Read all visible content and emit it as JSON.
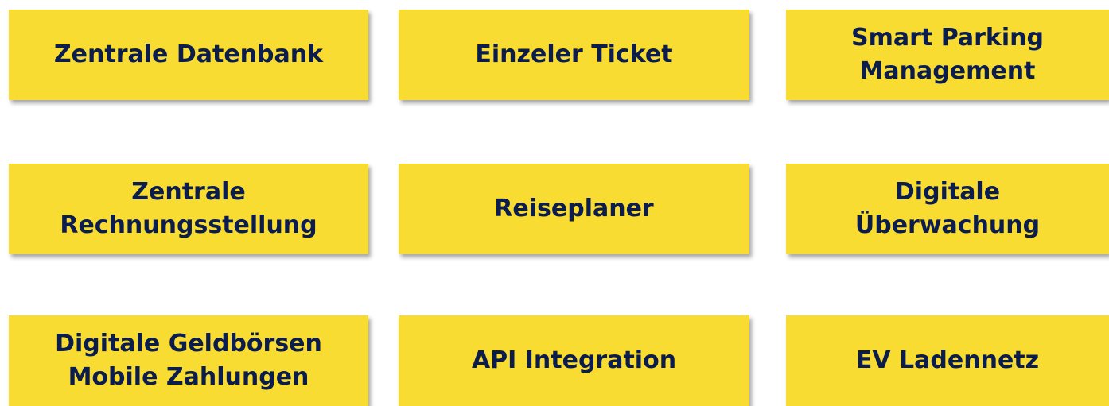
{
  "colors": {
    "tile_background": "#f9dc31",
    "text": "#0b1d4e",
    "page_background": "#ffffff"
  },
  "tiles": [
    {
      "lines": [
        "Zentrale Datenbank"
      ]
    },
    {
      "lines": [
        "Einzeler Ticket"
      ]
    },
    {
      "lines": [
        "Smart Parking",
        "Management"
      ]
    },
    {
      "lines": [
        "Zentrale",
        "Rechnungsstellung"
      ]
    },
    {
      "lines": [
        "Reiseplaner"
      ]
    },
    {
      "lines": [
        "Digitale",
        "Überwachung"
      ]
    },
    {
      "lines": [
        "Digitale Geldbörsen",
        "Mobile Zahlungen"
      ]
    },
    {
      "lines": [
        "API Integration"
      ]
    },
    {
      "lines": [
        "EV Ladennetz"
      ]
    }
  ]
}
